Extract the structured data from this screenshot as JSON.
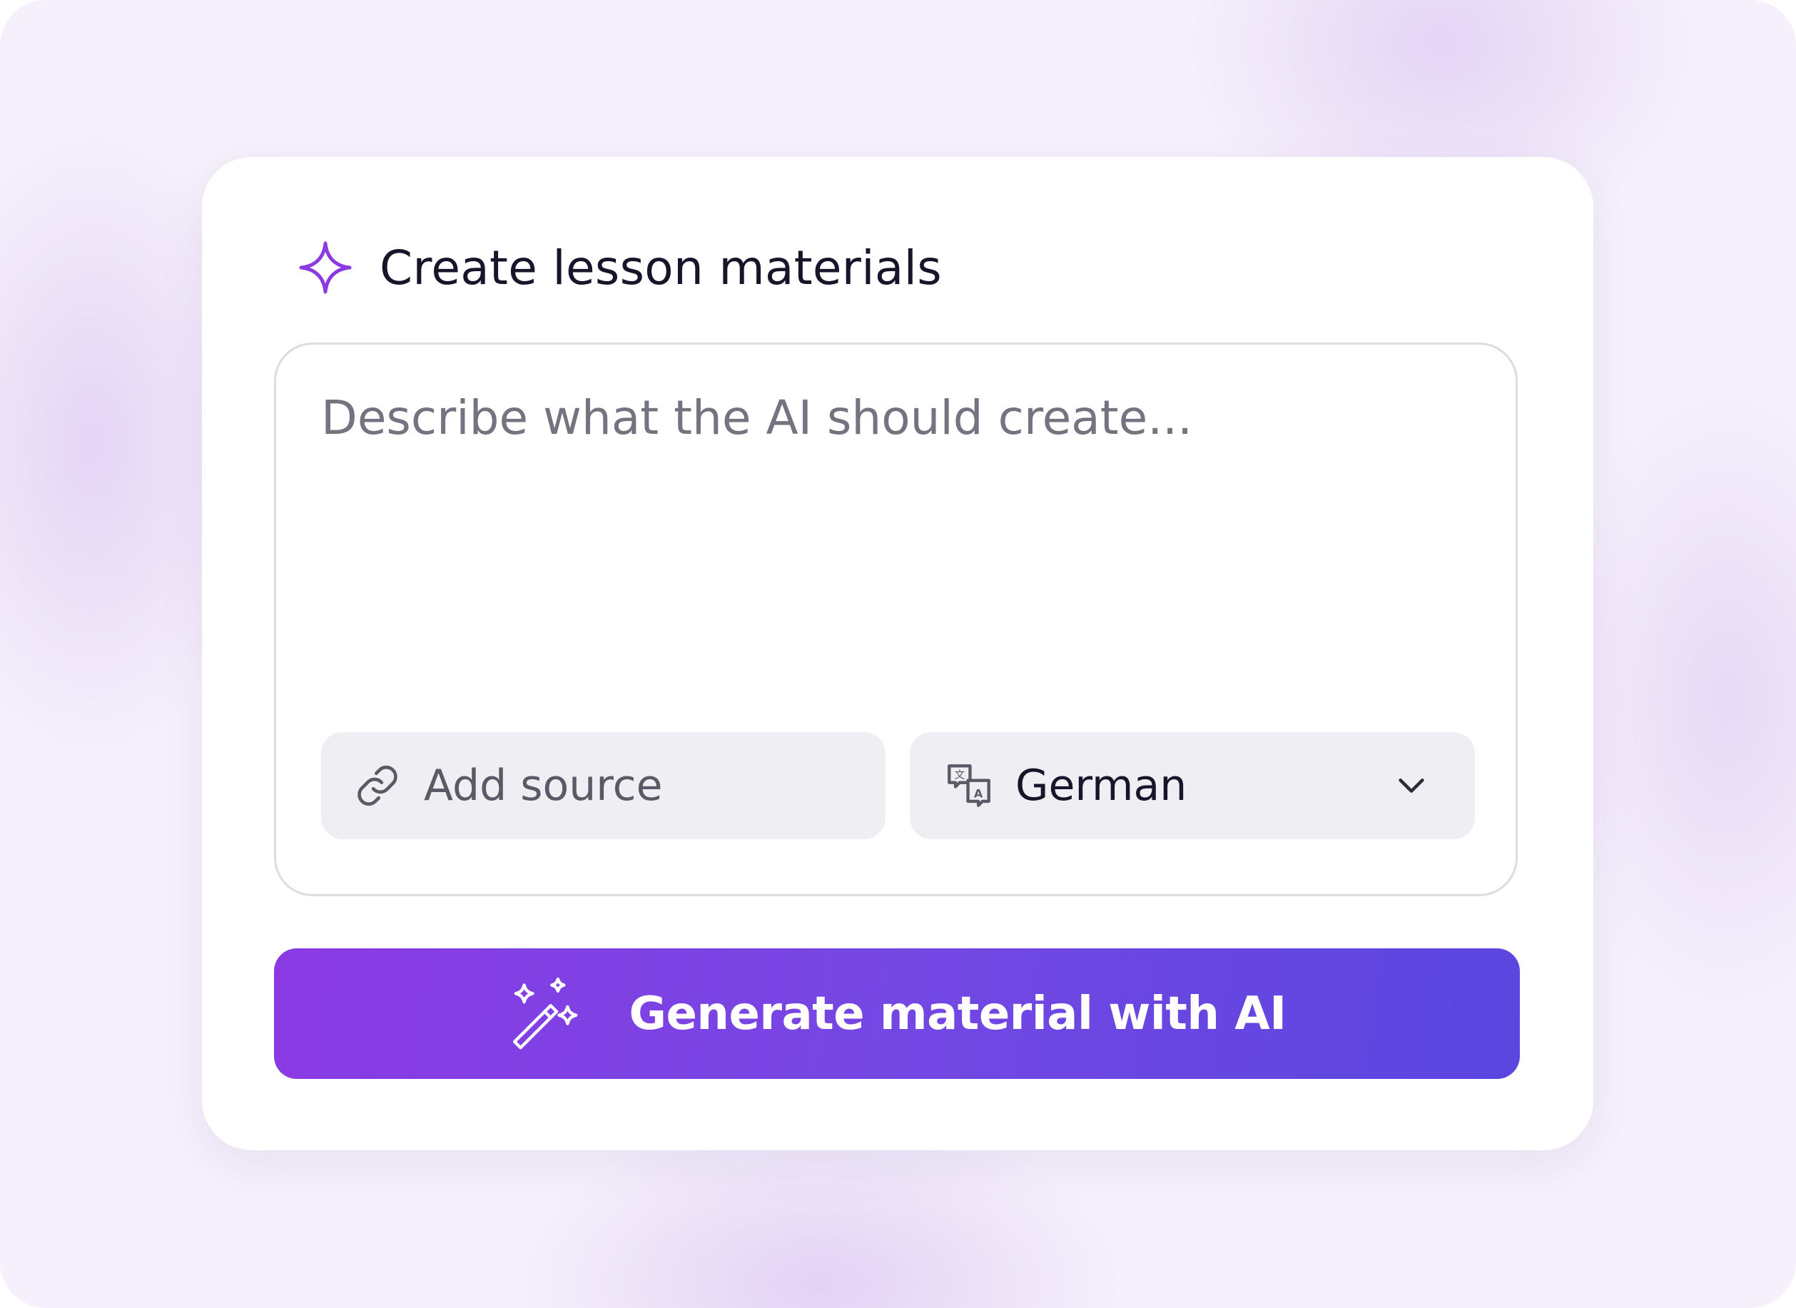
{
  "header": {
    "icon": "sparkle-icon",
    "title": "Create lesson materials"
  },
  "prompt": {
    "placeholder": "Describe what the AI should create...",
    "value": ""
  },
  "source_button": {
    "icon": "link-icon",
    "label": "Add source"
  },
  "language_select": {
    "icon": "translate-icon",
    "selected": "German",
    "caret_icon": "chevron-down-icon"
  },
  "generate_button": {
    "icon": "magic-wand-icon",
    "label": "Generate material with AI"
  },
  "colors": {
    "accent": "#8b3ae3",
    "button_gradient_start": "#8b3ae3",
    "button_gradient_end": "#5a46df",
    "background": "#f5f0fb",
    "pill_background": "#efeef3",
    "title_text": "#17152a",
    "placeholder_text": "#74737f"
  }
}
